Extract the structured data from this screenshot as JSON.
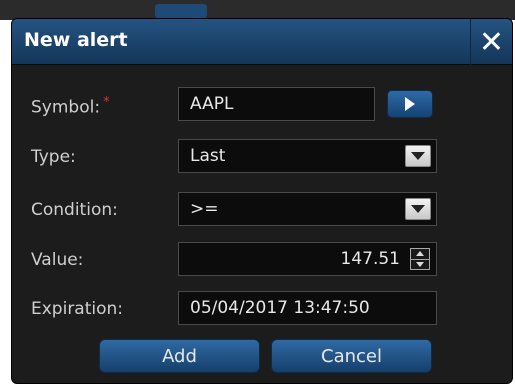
{
  "dialog": {
    "title": "New alert",
    "close_glyph": "✕"
  },
  "form": {
    "symbol": {
      "label": "Symbol:",
      "required_mark": "*",
      "value": "AAPL"
    },
    "type": {
      "label": "Type:",
      "value": "Last"
    },
    "condition": {
      "label": "Condition:",
      "value": ">="
    },
    "value": {
      "label": "Value:",
      "value": "147.51"
    },
    "expiration": {
      "label": "Expiration:",
      "value": "05/04/2017 13:47:50"
    }
  },
  "buttons": {
    "add": "Add",
    "cancel": "Cancel"
  },
  "icons": {
    "close": "close-icon",
    "go": "play-arrow-icon",
    "dropdown": "chevron-down-icon",
    "spinner": "spinner-icon"
  },
  "colors": {
    "titlebar": "#1d4a76",
    "dialog_bg": "#1c1c1c",
    "field_bg": "#0c0c0c",
    "button": "#245382",
    "required": "#dd3333"
  }
}
